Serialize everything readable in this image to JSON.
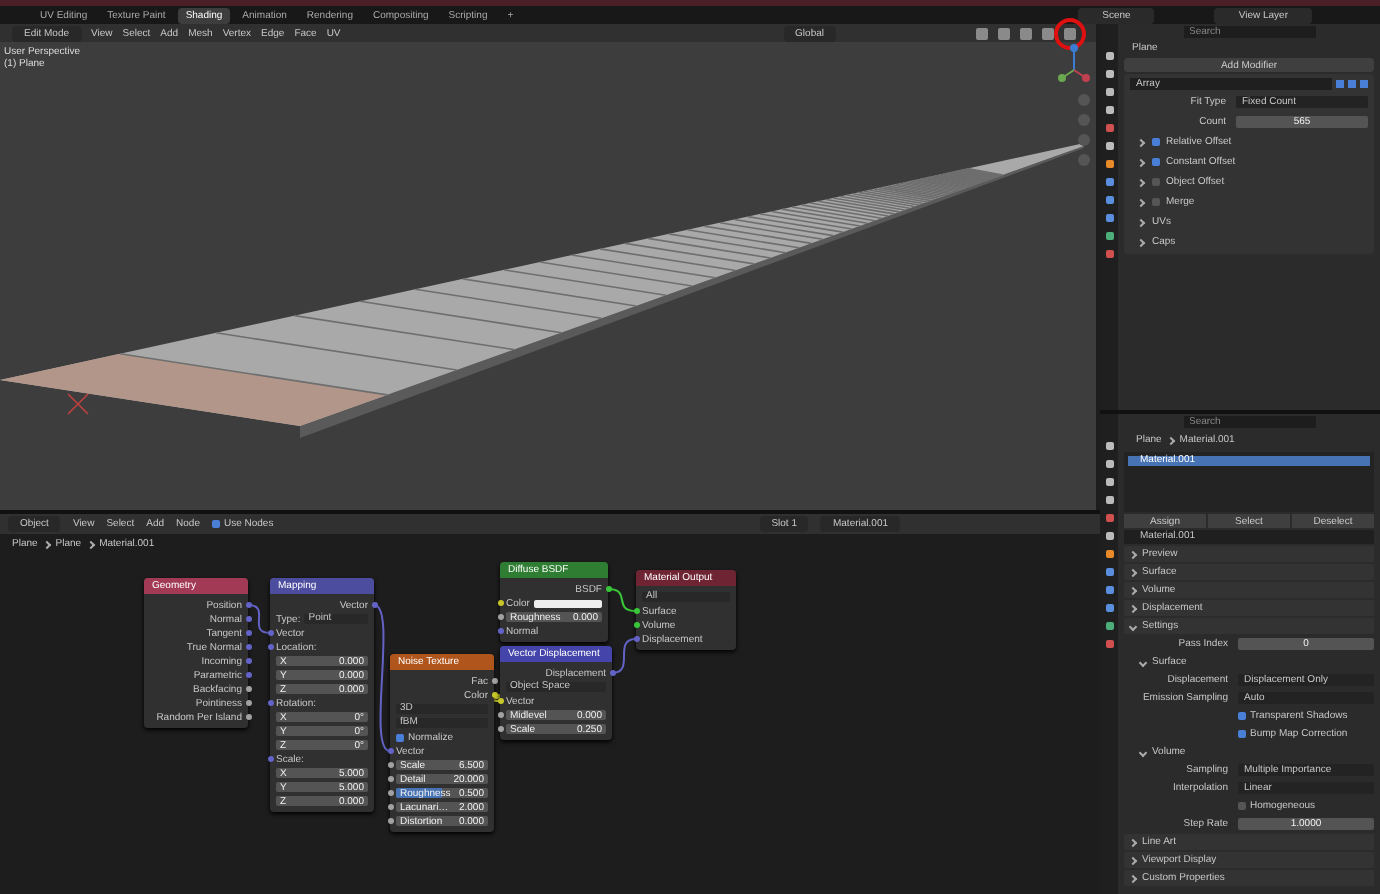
{
  "workspace_tabs": [
    {
      "label": "UV Editing",
      "selected": false
    },
    {
      "label": "Texture Paint",
      "selected": false
    },
    {
      "label": "Shading",
      "selected": true
    },
    {
      "label": "Animation",
      "selected": false
    },
    {
      "label": "Rendering",
      "selected": false
    },
    {
      "label": "Compositing",
      "selected": false
    },
    {
      "label": "Scripting",
      "selected": false
    }
  ],
  "add_tab": "+",
  "scene": "Scene",
  "view_layer": "View Layer",
  "viewport": {
    "mode": "Edit Mode",
    "menus": [
      "View",
      "Select",
      "Add",
      "Mesh",
      "Vertex",
      "Edge",
      "Face",
      "UV"
    ],
    "orientation": "Global",
    "info": [
      "User Perspective",
      "(1) Plane"
    ],
    "highlighted_button": true
  },
  "modifier_panel": {
    "search": {
      "placeholder": "Search"
    },
    "object": "Plane",
    "add_button": "Add Modifier",
    "modifier": {
      "name": "Array",
      "fields": [
        {
          "label": "Fit Type",
          "value": "Fixed Count",
          "kind": "dropdown"
        },
        {
          "label": "Count",
          "value": "565",
          "kind": "number"
        }
      ],
      "subpanels": [
        {
          "label": "Relative Offset",
          "kind": "check",
          "checked": true
        },
        {
          "label": "Constant Offset",
          "kind": "check",
          "checked": true
        },
        {
          "label": "Object Offset",
          "kind": "check",
          "checked": false
        },
        {
          "label": "Merge",
          "kind": "check",
          "checked": false
        },
        {
          "label": "UVs",
          "kind": "plain"
        },
        {
          "label": "Caps",
          "kind": "plain"
        }
      ]
    }
  },
  "material_panel": {
    "search": {
      "placeholder": "Search"
    },
    "breadcrumb": [
      "Plane",
      "Material.001"
    ],
    "slots": [
      {
        "name": "Material.001",
        "selected": true
      }
    ],
    "buttons": [
      "Assign",
      "Select",
      "Deselect"
    ],
    "material_name": "Material.001",
    "sections": [
      {
        "kind": "panel",
        "label": "Preview",
        "expanded": false
      },
      {
        "kind": "panel",
        "label": "Surface",
        "expanded": false
      },
      {
        "kind": "panel",
        "label": "Volume",
        "expanded": false
      },
      {
        "kind": "panel",
        "label": "Displacement",
        "expanded": false
      },
      {
        "kind": "panel",
        "label": "Settings",
        "expanded": true
      },
      {
        "kind": "field",
        "label": "Pass Index",
        "value": "0"
      },
      {
        "kind": "subpanel",
        "label": "Surface",
        "expanded": true
      },
      {
        "kind": "dropdown",
        "label": "Displacement",
        "value": "Displacement Only"
      },
      {
        "kind": "dropdown",
        "label": "Emission Sampling",
        "value": "Auto"
      },
      {
        "kind": "check",
        "label": "Transparent Shadows",
        "checked": true
      },
      {
        "kind": "check",
        "label": "Bump Map Correction",
        "checked": true
      },
      {
        "kind": "subpanel",
        "label": "Volume",
        "expanded": true
      },
      {
        "kind": "dropdown",
        "label": "Sampling",
        "value": "Multiple Importance"
      },
      {
        "kind": "dropdown",
        "label": "Interpolation",
        "value": "Linear"
      },
      {
        "kind": "check",
        "label": "Homogeneous",
        "checked": false
      },
      {
        "kind": "field",
        "label": "Step Rate",
        "value": "1.0000"
      },
      {
        "kind": "panel",
        "label": "Line Art",
        "expanded": false
      },
      {
        "kind": "panel",
        "label": "Viewport Display",
        "expanded": false
      },
      {
        "kind": "panel",
        "label": "Custom Properties",
        "expanded": false
      }
    ]
  },
  "node_editor": {
    "object_mode": "Object",
    "menus": [
      "View",
      "Select",
      "Add",
      "Node"
    ],
    "use_nodes": {
      "label": "Use Nodes",
      "checked": true
    },
    "slot": "Slot 1",
    "material": "Material.001",
    "breadcrumb": [
      "Plane",
      "Plane",
      "Material.001"
    ],
    "nodes": [
      {
        "title": "Geometry",
        "color": "#a23a55",
        "rows": [
          {
            "kind": "out",
            "label": "Position",
            "color": "#6363c7"
          },
          {
            "kind": "out",
            "label": "Normal",
            "color": "#6363c7"
          },
          {
            "kind": "out",
            "label": "Tangent",
            "color": "#6363c7"
          },
          {
            "kind": "out",
            "label": "True Normal",
            "color": "#6363c7"
          },
          {
            "kind": "out",
            "label": "Incoming",
            "color": "#6363c7"
          },
          {
            "kind": "out",
            "label": "Parametric",
            "color": "#6363c7"
          },
          {
            "kind": "out",
            "label": "Backfacing",
            "color": "#a1a1a1"
          },
          {
            "kind": "out",
            "label": "Pointiness",
            "color": "#a1a1a1"
          },
          {
            "kind": "out",
            "label": "Random Per Island",
            "color": "#a1a1a1"
          }
        ]
      },
      {
        "title": "Mapping",
        "color": "#4d4da0",
        "rows": [
          {
            "kind": "out",
            "label": "Vector",
            "color": "#6363c7"
          },
          {
            "kind": "dropdown",
            "label": "Type:",
            "value": "Point"
          },
          {
            "kind": "in",
            "label": "Vector",
            "color": "#6363c7"
          },
          {
            "kind": "in",
            "label": "Location:",
            "color": "#6363c7"
          },
          {
            "kind": "prop",
            "label": "X",
            "value": "0.000"
          },
          {
            "kind": "prop",
            "label": "Y",
            "value": "0.000"
          },
          {
            "kind": "prop",
            "label": "Z",
            "value": "0.000"
          },
          {
            "kind": "in",
            "label": "Rotation:",
            "color": "#6363c7"
          },
          {
            "kind": "prop",
            "label": "X",
            "value": "0°"
          },
          {
            "kind": "prop",
            "label": "Y",
            "value": "0°"
          },
          {
            "kind": "prop",
            "label": "Z",
            "value": "0°"
          },
          {
            "kind": "in",
            "label": "Scale:",
            "color": "#6363c7"
          },
          {
            "kind": "prop",
            "label": "X",
            "value": "5.000"
          },
          {
            "kind": "prop",
            "label": "Y",
            "value": "5.000"
          },
          {
            "kind": "prop",
            "label": "Z",
            "value": "0.000"
          }
        ]
      },
      {
        "title": "Noise Texture",
        "color": "#b0561c",
        "rows": [
          {
            "kind": "out",
            "label": "Fac",
            "color": "#a1a1a1"
          },
          {
            "kind": "out",
            "label": "Color",
            "color": "#c7c729"
          },
          {
            "kind": "dropdown",
            "value": "3D"
          },
          {
            "kind": "dropdown",
            "value": "fBM"
          },
          {
            "kind": "check",
            "label": "Normalize",
            "checked": true
          },
          {
            "kind": "in",
            "label": "Vector",
            "color": "#6363c7"
          },
          {
            "kind": "field",
            "label": "Scale",
            "value": "6.500",
            "color": "#a1a1a1"
          },
          {
            "kind": "field",
            "label": "Detail",
            "value": "20.000",
            "color": "#a1a1a1"
          },
          {
            "kind": "field",
            "label": "Roughness",
            "value": "0.500",
            "color": "#a1a1a1",
            "level": 0.5
          },
          {
            "kind": "field",
            "label": "Lacunari…",
            "value": "2.000",
            "color": "#a1a1a1"
          },
          {
            "kind": "field",
            "label": "Distortion",
            "value": "0.000",
            "color": "#a1a1a1"
          }
        ]
      },
      {
        "title": "Diffuse BSDF",
        "color": "#2e7d32",
        "rows": [
          {
            "kind": "out",
            "label": "BSDF",
            "color": "#39c739"
          },
          {
            "kind": "color_in",
            "label": "Color",
            "color": "#c7c729"
          },
          {
            "kind": "field",
            "label": "Roughness",
            "value": "0.000",
            "color": "#a1a1a1"
          },
          {
            "kind": "in",
            "label": "Normal",
            "color": "#6363c7"
          }
        ]
      },
      {
        "title": "Vector Displacement",
        "color": "#4444aa",
        "rows": [
          {
            "kind": "out",
            "label": "Displacement",
            "color": "#6363c7"
          },
          {
            "kind": "dropdown",
            "value": "Object Space"
          },
          {
            "kind": "in",
            "label": "Vector",
            "color": "#c7c729"
          },
          {
            "kind": "field",
            "label": "Midlevel",
            "value": "0.000",
            "color": "#a1a1a1"
          },
          {
            "kind": "field",
            "label": "Scale",
            "value": "0.250",
            "color": "#a1a1a1"
          }
        ]
      },
      {
        "title": "Material Output",
        "color": "#6e2433",
        "rows": [
          {
            "kind": "dropdown",
            "value": "All"
          },
          {
            "kind": "in",
            "label": "Surface",
            "color": "#39c739"
          },
          {
            "kind": "in",
            "label": "Volume",
            "color": "#39c739"
          },
          {
            "kind": "in",
            "label": "Displacement",
            "color": "#6363c7"
          }
        ]
      }
    ]
  }
}
